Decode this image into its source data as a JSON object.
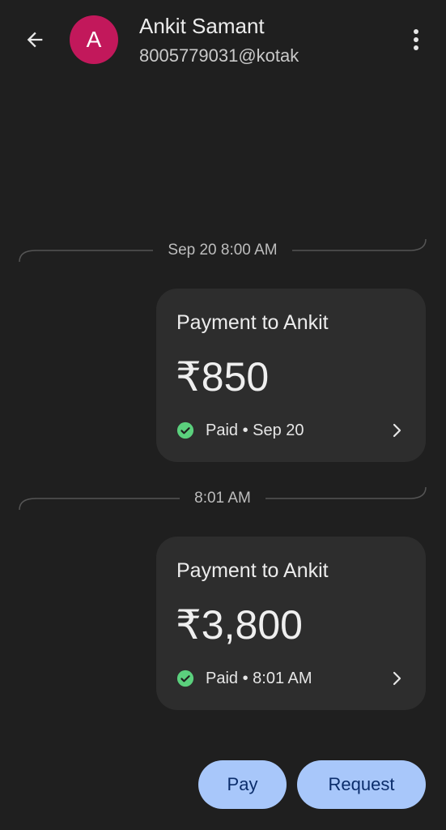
{
  "header": {
    "back_icon": "arrow-left-icon",
    "avatar_letter": "A",
    "avatar_color": "#c2185b",
    "name": "Ankit Samant",
    "upi_id": "8005779031@kotak",
    "menu_icon": "more-vertical-icon"
  },
  "timeline": [
    {
      "timestamp": "Sep 20 8:00 AM",
      "card": {
        "title": "Payment to Ankit",
        "amount": "₹850",
        "status": "Paid • Sep 20",
        "status_icon": "check-circle-icon",
        "status_color": "#5bd07d"
      }
    },
    {
      "timestamp": "8:01 AM",
      "card": {
        "title": "Payment to Ankit",
        "amount": "₹3,800",
        "status": "Paid • 8:01 AM",
        "status_icon": "check-circle-icon",
        "status_color": "#5bd07d"
      }
    }
  ],
  "actions": {
    "pay_label": "Pay",
    "request_label": "Request",
    "button_color": "#a8c7fa"
  }
}
